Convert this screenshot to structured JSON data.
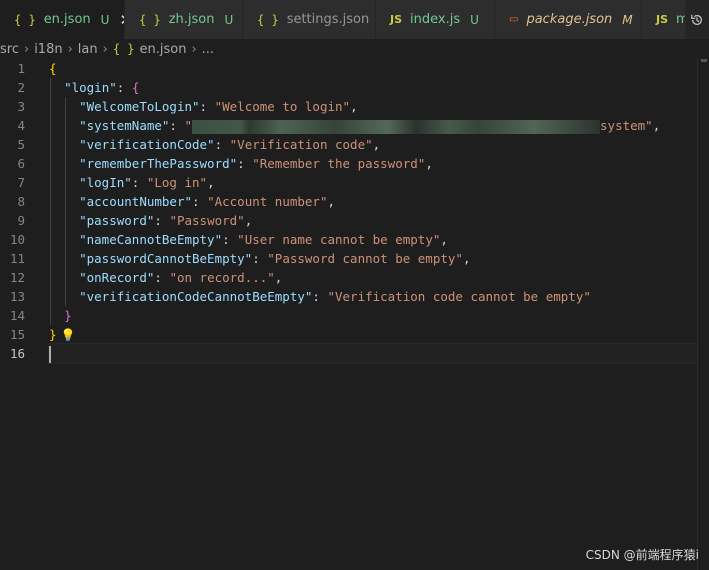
{
  "tabs": [
    {
      "icon": "{ }",
      "name": "en.json",
      "status": "U",
      "close": "✕"
    },
    {
      "icon": "{ }",
      "name": "zh.json",
      "status": "U"
    },
    {
      "icon": "{ }",
      "name": "settings.json"
    },
    {
      "icon": "JS",
      "name": "index.js",
      "status": "U"
    },
    {
      "icon": "▭",
      "name": "package.json",
      "status": "M"
    },
    {
      "icon": "JS",
      "name": "m"
    }
  ],
  "breadcrumb": [
    "src",
    "i18n",
    "lan",
    "en.json",
    "..."
  ],
  "breadcrumb_icon": "{ }",
  "editor": {
    "line_numbers": [
      "1",
      "2",
      "3",
      "4",
      "5",
      "6",
      "7",
      "8",
      "9",
      "10",
      "11",
      "12",
      "13",
      "14",
      "15",
      "16"
    ],
    "open_brace": "{",
    "close_brace": "}",
    "login_key": "\"login\"",
    "inner_open": "{",
    "inner_close": "}",
    "entries": [
      {
        "key": "\"WelcomeToLogin\"",
        "value": "\"Welcome to login\""
      },
      {
        "key": "\"systemName\"",
        "value_start": "\"",
        "value_end": "system\""
      },
      {
        "key": "\"verificationCode\"",
        "value": "\"Verification code\""
      },
      {
        "key": "\"rememberThePassword\"",
        "value": "\"Remember the password\""
      },
      {
        "key": "\"logIn\"",
        "value": "\"Log in\""
      },
      {
        "key": "\"accountNumber\"",
        "value": "\"Account number\""
      },
      {
        "key": "\"password\"",
        "value": "\"Password\""
      },
      {
        "key": "\"nameCannotBeEmpty\"",
        "value": "\"User name cannot be empty\""
      },
      {
        "key": "\"passwordCannotBeEmpty\"",
        "value": "\"Password cannot be empty\""
      },
      {
        "key": "\"onRecord\"",
        "value": "\"on record...\""
      },
      {
        "key": "\"verificationCodeCannotBeEmpty\"",
        "value": "\"Verification code cannot be empty\""
      }
    ]
  },
  "watermark": "CSDN @前端程序猿i",
  "colors": {
    "key": "#9cdcfe",
    "string": "#ce9178",
    "brace_outer": "#ffd700",
    "brace_inner": "#da70d6",
    "untracked": "#73c991",
    "modified": "#e2c08d"
  }
}
